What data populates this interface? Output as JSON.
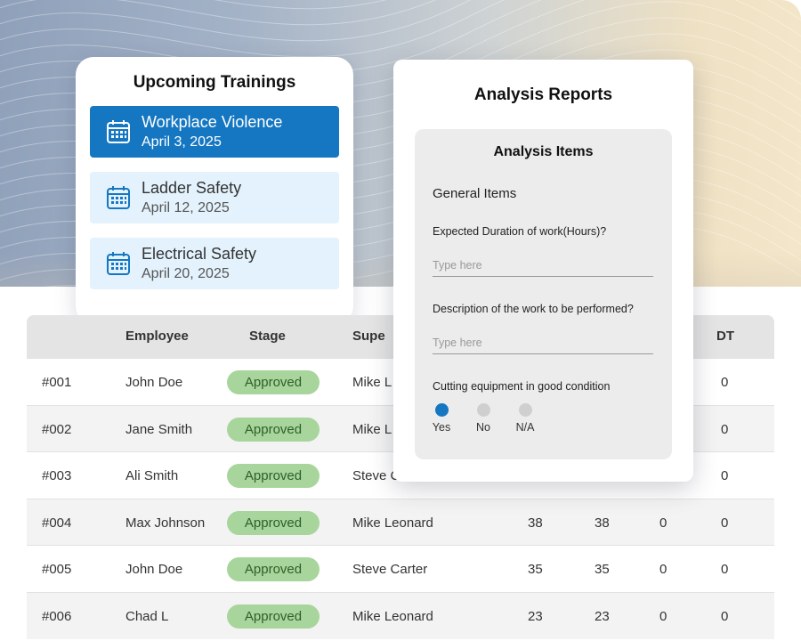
{
  "trainings": {
    "title": "Upcoming Trainings",
    "items": [
      {
        "name": "Workplace Violence",
        "date": "April 3, 2025",
        "active": true
      },
      {
        "name": "Ladder Safety",
        "date": "April 12, 2025",
        "active": false
      },
      {
        "name": "Electrical Safety",
        "date": "April 20, 2025",
        "active": false
      }
    ]
  },
  "table": {
    "headers": {
      "id": "",
      "employee": "Employee",
      "stage": "Stage",
      "supervisor": "Supe",
      "dt": "DT"
    },
    "rows": [
      {
        "id": "#001",
        "employee": "John Doe",
        "stage": "Approved",
        "supervisor": "Mike L",
        "c1": "",
        "c2": "",
        "c3": "",
        "dt": "0"
      },
      {
        "id": "#002",
        "employee": "Jane Smith",
        "stage": "Approved",
        "supervisor": "Mike L",
        "c1": "",
        "c2": "",
        "c3": "",
        "dt": "0"
      },
      {
        "id": "#003",
        "employee": "Ali Smith",
        "stage": "Approved",
        "supervisor": "Steve C",
        "c1": "",
        "c2": "",
        "c3": "",
        "dt": "0"
      },
      {
        "id": "#004",
        "employee": "Max Johnson",
        "stage": "Approved",
        "supervisor": "Mike Leonard",
        "c1": "38",
        "c2": "38",
        "c3": "0",
        "dt": "0"
      },
      {
        "id": "#005",
        "employee": "John Doe",
        "stage": "Approved",
        "supervisor": "Steve Carter",
        "c1": "35",
        "c2": "35",
        "c3": "0",
        "dt": "0"
      },
      {
        "id": "#006",
        "employee": "Chad L",
        "stage": "Approved",
        "supervisor": "Mike Leonard",
        "c1": "23",
        "c2": "23",
        "c3": "0",
        "dt": "0"
      }
    ]
  },
  "reports": {
    "title": "Analysis Reports",
    "panel_title": "Analysis Items",
    "section": "General Items",
    "questions": [
      {
        "label": "Expected Duration of work(Hours)?",
        "placeholder": "Type here",
        "value": ""
      },
      {
        "label": "Description of the work to be performed?",
        "placeholder": "Type here",
        "value": ""
      }
    ],
    "radio_question": "Cutting equipment in good condition",
    "radio_options": [
      {
        "label": "Yes",
        "checked": true
      },
      {
        "label": "No",
        "checked": false
      },
      {
        "label": "N/A",
        "checked": false
      }
    ]
  },
  "colors": {
    "accent": "#1577c2",
    "approved_badge": "#a7d59b",
    "training_item_bg": "#e3f2fc"
  },
  "icons": {
    "training": "calendar-icon"
  }
}
